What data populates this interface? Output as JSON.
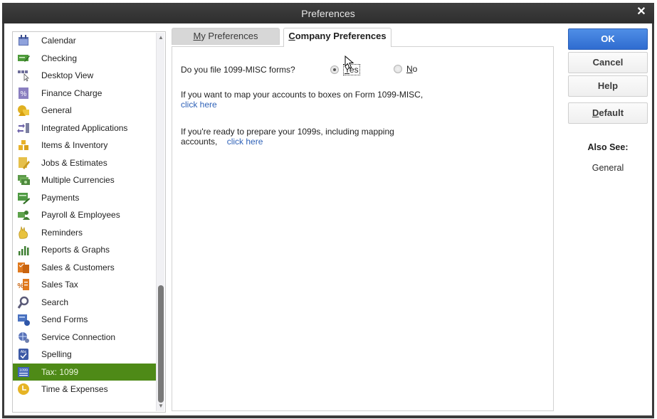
{
  "window": {
    "title": "Preferences",
    "close_icon": "close-icon"
  },
  "sidebar": {
    "selected_index": 20,
    "items": [
      {
        "label": "Calendar",
        "icon": "calendar-icon"
      },
      {
        "label": "Checking",
        "icon": "checking-icon"
      },
      {
        "label": "Desktop View",
        "icon": "desktop-view-icon"
      },
      {
        "label": "Finance Charge",
        "icon": "finance-charge-icon"
      },
      {
        "label": "General",
        "icon": "general-icon"
      },
      {
        "label": "Integrated Applications",
        "icon": "integrated-applications-icon"
      },
      {
        "label": "Items & Inventory",
        "icon": "items-inventory-icon"
      },
      {
        "label": "Jobs & Estimates",
        "icon": "jobs-estimates-icon"
      },
      {
        "label": "Multiple Currencies",
        "icon": "multiple-currencies-icon"
      },
      {
        "label": "Payments",
        "icon": "payments-icon"
      },
      {
        "label": "Payroll & Employees",
        "icon": "payroll-employees-icon"
      },
      {
        "label": "Reminders",
        "icon": "reminders-icon"
      },
      {
        "label": "Reports & Graphs",
        "icon": "reports-graphs-icon"
      },
      {
        "label": "Sales & Customers",
        "icon": "sales-customers-icon"
      },
      {
        "label": "Sales Tax",
        "icon": "sales-tax-icon"
      },
      {
        "label": "Search",
        "icon": "search-icon"
      },
      {
        "label": "Send Forms",
        "icon": "send-forms-icon"
      },
      {
        "label": "Service Connection",
        "icon": "service-connection-icon"
      },
      {
        "label": "Spelling",
        "icon": "spelling-icon"
      },
      {
        "label": "Tax: 1099",
        "icon": "tax-1099-icon"
      },
      {
        "label": "Time & Expenses",
        "icon": "time-expenses-icon"
      }
    ]
  },
  "tabs": {
    "my_preferences": {
      "mnemonic": "M",
      "rest": "y Preferences"
    },
    "company_preferences": {
      "mnemonic": "C",
      "rest": "ompany Preferences",
      "active": true
    }
  },
  "company_prefs": {
    "question": "Do you file 1099-MISC forms?",
    "options": [
      {
        "mnemonic": "Y",
        "rest": "es",
        "checked": true
      },
      {
        "mnemonic": "N",
        "rest": "o",
        "checked": false
      }
    ],
    "map_text": "If you want to map your accounts to boxes on Form 1099-MISC,",
    "map_link": "click here",
    "prepare_text_line1": "If you're ready to prepare your 1099s, including mapping",
    "prepare_text_line2": "accounts,",
    "prepare_link": "click here"
  },
  "buttons": {
    "ok": "OK",
    "cancel": "Cancel",
    "help": "Help",
    "default_mnemonic": "D",
    "default_rest": "efault"
  },
  "also_see": {
    "heading": "Also See:",
    "links": [
      "General"
    ]
  },
  "colors": {
    "selected_item": "#4e8a17",
    "ok_button": "#3a7bd9",
    "link": "#2f62b8",
    "titlebar": "#353535"
  }
}
